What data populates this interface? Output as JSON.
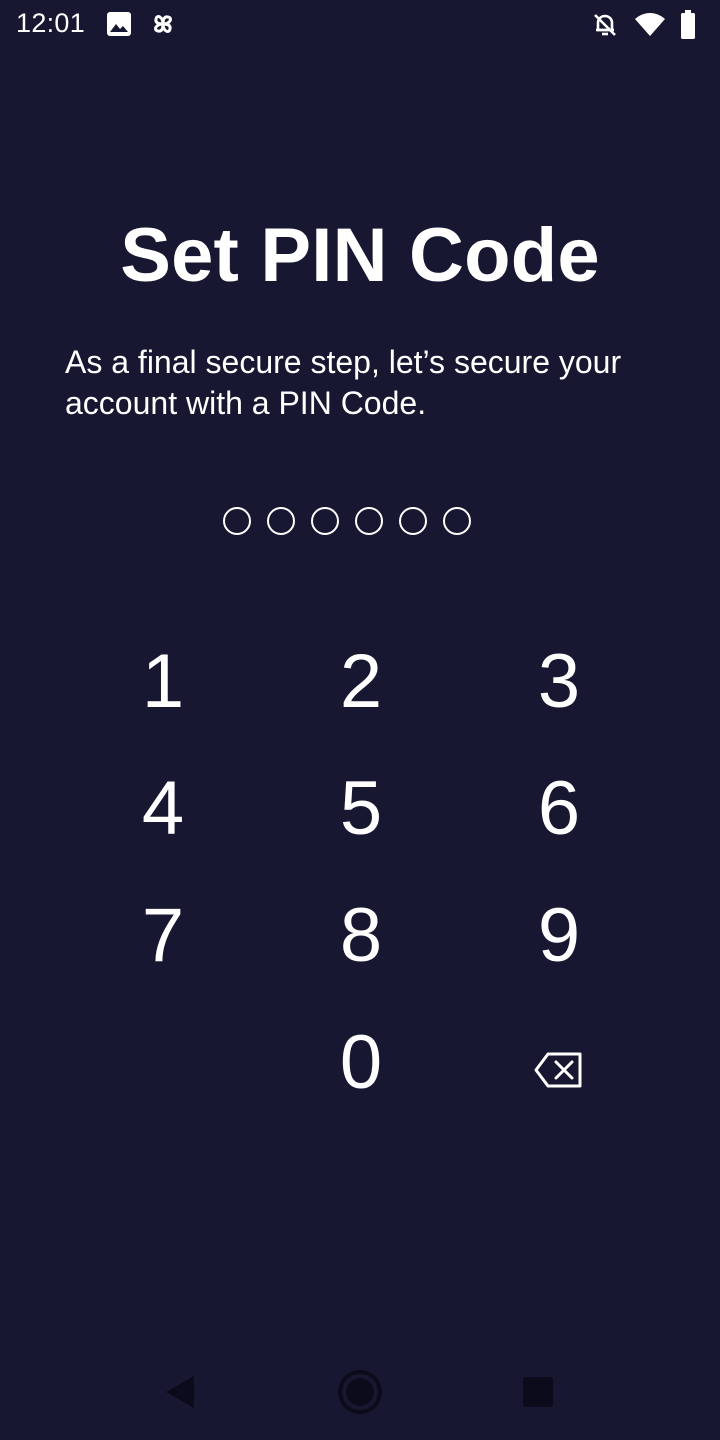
{
  "status_bar": {
    "time": "12:01",
    "left_icons": [
      "image-icon",
      "pinwheel-icon"
    ],
    "right_icons": [
      "bell-off-icon",
      "wifi-icon",
      "battery-icon"
    ]
  },
  "screen": {
    "title": "Set PIN Code",
    "subtitle": "As a final secure step, let’s secure your account with a PIN Code.",
    "pin_length": 6,
    "pin_filled": 0
  },
  "keypad": {
    "keys": [
      "1",
      "2",
      "3",
      "4",
      "5",
      "6",
      "7",
      "8",
      "9",
      "",
      "0",
      "backspace-icon"
    ]
  },
  "nav_bar": {
    "buttons": [
      "back-icon",
      "home-icon",
      "recents-icon"
    ]
  },
  "colors": {
    "background": "#171732",
    "foreground": "#ffffff",
    "nav_icons": "#0b0b1c"
  }
}
